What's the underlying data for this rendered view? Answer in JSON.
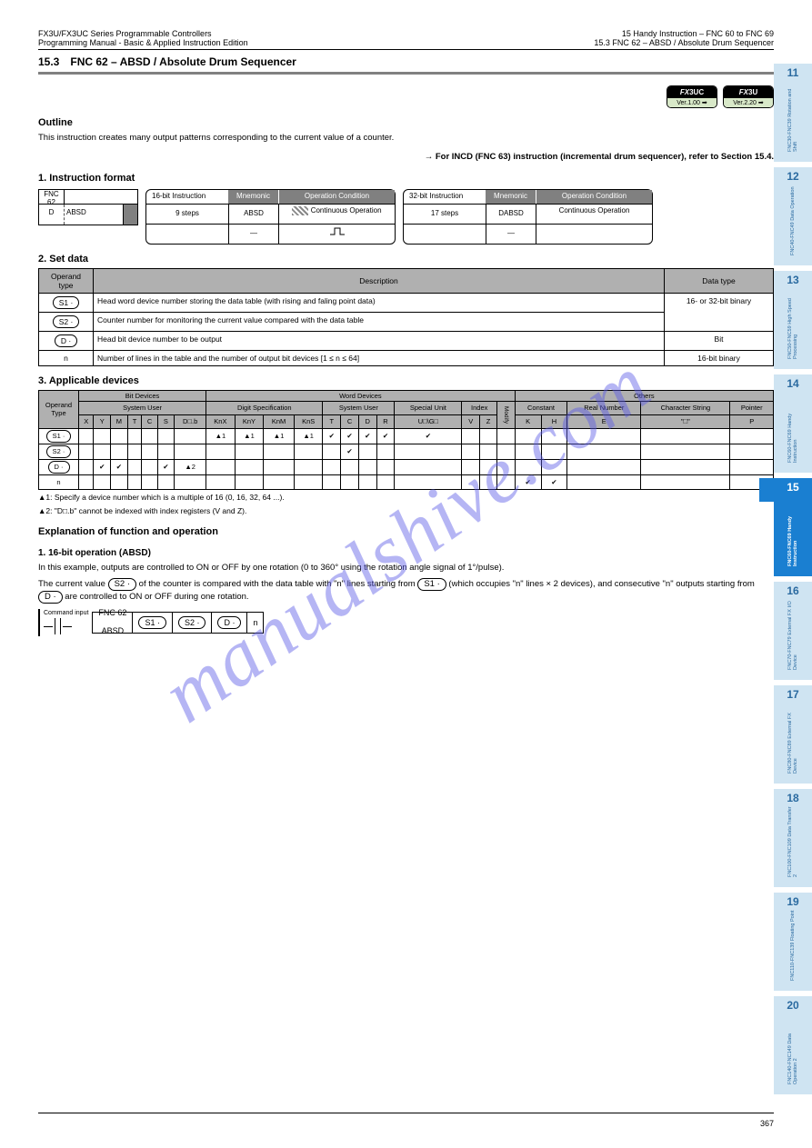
{
  "header": {
    "left_line1": "FX3U/FX3UC Series Programmable Controllers",
    "left_line2": "Programming Manual - Basic & Applied Instruction Edition",
    "right_line1": "15 Handy Instruction – FNC 60 to FNC 69",
    "right_line2": "15.3 FNC 62 – ABSD / Absolute Drum Sequencer"
  },
  "section": {
    "number": "15.3",
    "title": "FNC 62 – ABSD / Absolute Drum Sequencer"
  },
  "badges": [
    {
      "top_fx": "FX",
      "top_suffix": "3UC",
      "bottom": "Ver.1.00 ➡"
    },
    {
      "top_fx": "FX",
      "top_suffix": "3U",
      "bottom": "Ver.2.20 ➡"
    }
  ],
  "outline": {
    "heading": "Outline",
    "p1": "This instruction creates many output patterns corresponding to the current value of a counter.",
    "p2_prefix": "→ ",
    "p2": "For INCD (FNC 63) instruction (incremental drum sequencer), refer to Section 15.4."
  },
  "inst_format": {
    "heading": "1. Instruction format",
    "left": {
      "fnc": "FNC 62",
      "name": "ABSD",
      "dp_col": "D"
    },
    "box16": {
      "label": "16-bit Instruction",
      "mnem_hdr": "Mnemonic",
      "cond_hdr": "Operation Condition",
      "row1_steps": "9 steps",
      "row1_mnem": "ABSD",
      "row1_cond": "Continuous Operation",
      "row2_mnem": "—",
      "row2_cond": "—"
    },
    "box32": {
      "label": "32-bit Instruction",
      "mnem_hdr": "Mnemonic",
      "cond_hdr": "Operation Condition",
      "row1_steps": "17 steps",
      "row1_mnem": "DABSD",
      "row1_cond": "Continuous Operation",
      "row2_mnem": "—",
      "row2_cond": "—"
    }
  },
  "operands": {
    "heading": "2. Set data",
    "head": {
      "type": "Operand type",
      "desc": "Description",
      "dtype": "Data type"
    },
    "rows": [
      {
        "op": "S1 ·",
        "desc": "Head word device number storing the data table (with rising and faling point data)",
        "dtype": "16- or 32-bit binary"
      },
      {
        "op": "S2 ·",
        "desc": "Counter number for monitoring the current value compared with the data table",
        "dtype": "16- or 32-bit binary"
      },
      {
        "op": "D ·",
        "desc": "Head bit device number to be output",
        "dtype": "Bit"
      },
      {
        "op": "n",
        "desc": "Number of lines in the table and the number of output bit devices [1 ≤ n ≤ 64]",
        "dtype": "16-bit binary"
      }
    ]
  },
  "applicable": {
    "heading": "3. Applicable devices",
    "groups": {
      "col_operand": "Operand Type",
      "bit_devices": "Bit Devices",
      "word_devices": "Word Devices",
      "others": "Others",
      "sys_user_bit": "System User",
      "digit": "Digit Specification",
      "sys_user_word": "System User",
      "special_unit": "Special Unit",
      "index": "Index",
      "constant": "Constant",
      "real": "Real Number",
      "char": "Character String",
      "pointer": "Pointer"
    },
    "cols": [
      "X",
      "Y",
      "M",
      "T",
      "C",
      "S",
      "D□.b",
      "KnX",
      "KnY",
      "KnM",
      "KnS",
      "T",
      "C",
      "D",
      "R",
      "U□\\G□",
      "V",
      "Z",
      "Modify",
      "K",
      "H",
      "E",
      "\"□\"",
      "P"
    ],
    "rows": [
      {
        "op": "S1 ·",
        "marks": [
          "",
          "",
          "",
          "",
          "",
          "",
          "",
          "✔¹",
          "✔¹",
          "✔¹",
          "✔¹",
          "✔",
          "✔",
          "✔",
          "✔",
          "✔",
          "",
          "",
          "",
          "",
          "",
          "",
          "",
          ""
        ]
      },
      {
        "op": "S2 ·",
        "marks": [
          "",
          "",
          "",
          "",
          "",
          "",
          "",
          "",
          "",
          "",
          "",
          "",
          "✔",
          "",
          "",
          "",
          "",
          "",
          "",
          "",
          "",
          "",
          "",
          ""
        ]
      },
      {
        "op": "D ·",
        "marks": [
          "",
          "✔",
          "✔",
          "",
          "",
          "✔",
          "✔²",
          "",
          "",
          "",
          "",
          "",
          "",
          "",
          "",
          "",
          "",
          "",
          "",
          "",
          "",
          "",
          "",
          ""
        ]
      },
      {
        "op": "n",
        "marks": [
          "",
          "",
          "",
          "",
          "",
          "",
          "",
          "",
          "",
          "",
          "",
          "",
          "",
          "",
          "",
          "",
          "",
          "",
          "",
          "✔",
          "✔",
          "",
          "",
          ""
        ]
      }
    ],
    "note1": "▲1: Specify a device number which is a multiple of 16 (0, 16, 32, 64 ...).",
    "note2": "▲2: \"D□.b\" cannot be indexed with index registers (V and Z)."
  },
  "function": {
    "heading": "Explanation of function and operation",
    "sub_heading": "1. 16-bit operation (ABSD)",
    "para": "In this example, outputs are controlled to ON or OFF by one rotation (0 to 360° using the rotation angle signal of 1°/pulse).",
    "para2_pre": "The current value ",
    "para2_mid": " of the counter is compared with the data table with \"n\" lines starting from ",
    "para2_post": " (which occupies \"n\" lines × 2 devices), and consecutive \"n\" outputs starting from ",
    "para2_end": " are controlled to ON or OFF during one rotation.",
    "s1": "S1 ·",
    "s2": "S2 ·",
    "d": "D ·",
    "ladder": {
      "cmd_label": "Command input",
      "fnc": "FNC 62",
      "name": "ABSD",
      "s1": "S1 ·",
      "s2": "S2 ·",
      "d": "D ·",
      "n": "n"
    }
  },
  "tabs": [
    {
      "num": "11",
      "label": "FNC30-FNC39 Rotation and Shift"
    },
    {
      "num": "12",
      "label": "FNC40-FNC49 Data Operation"
    },
    {
      "num": "13",
      "label": "FNC50-FNC59 High Speed Processing"
    },
    {
      "num": "14",
      "label": "FNC60-FNC69 Handy Instruction"
    },
    {
      "num": "15",
      "label": "FNC60-FNC69 Handy Instruction",
      "current": true
    },
    {
      "num": "16",
      "label": "FNC70-FNC79 External FX I/O Device"
    },
    {
      "num": "17",
      "label": "FNC80-FNC89 External FX Device"
    },
    {
      "num": "18",
      "label": "FNC100-FNC109 Data Transfer 2"
    },
    {
      "num": "19",
      "label": "FNC110-FNC139 Floating Point"
    },
    {
      "num": "20",
      "label": "FNC140-FNC149 Data Operation 2"
    }
  ],
  "footer": {
    "page": "367"
  },
  "watermark": "manualshive.com"
}
